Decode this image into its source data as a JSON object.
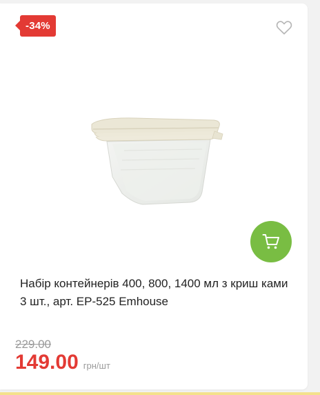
{
  "badge": {
    "discount": "-34%"
  },
  "product": {
    "title": "Набір контейнерів 400, 800, 1400 мл з криш ками 3 шт., арт. EP-525 Emhouse",
    "old_price": "229.00",
    "price": "149.00",
    "unit": "грн/шт"
  },
  "icons": {
    "favorite": "heart-outline-icon",
    "cart": "cart-icon"
  },
  "colors": {
    "badge": "#e33a34",
    "price": "#e33a34",
    "cart_button": "#79bd43"
  }
}
